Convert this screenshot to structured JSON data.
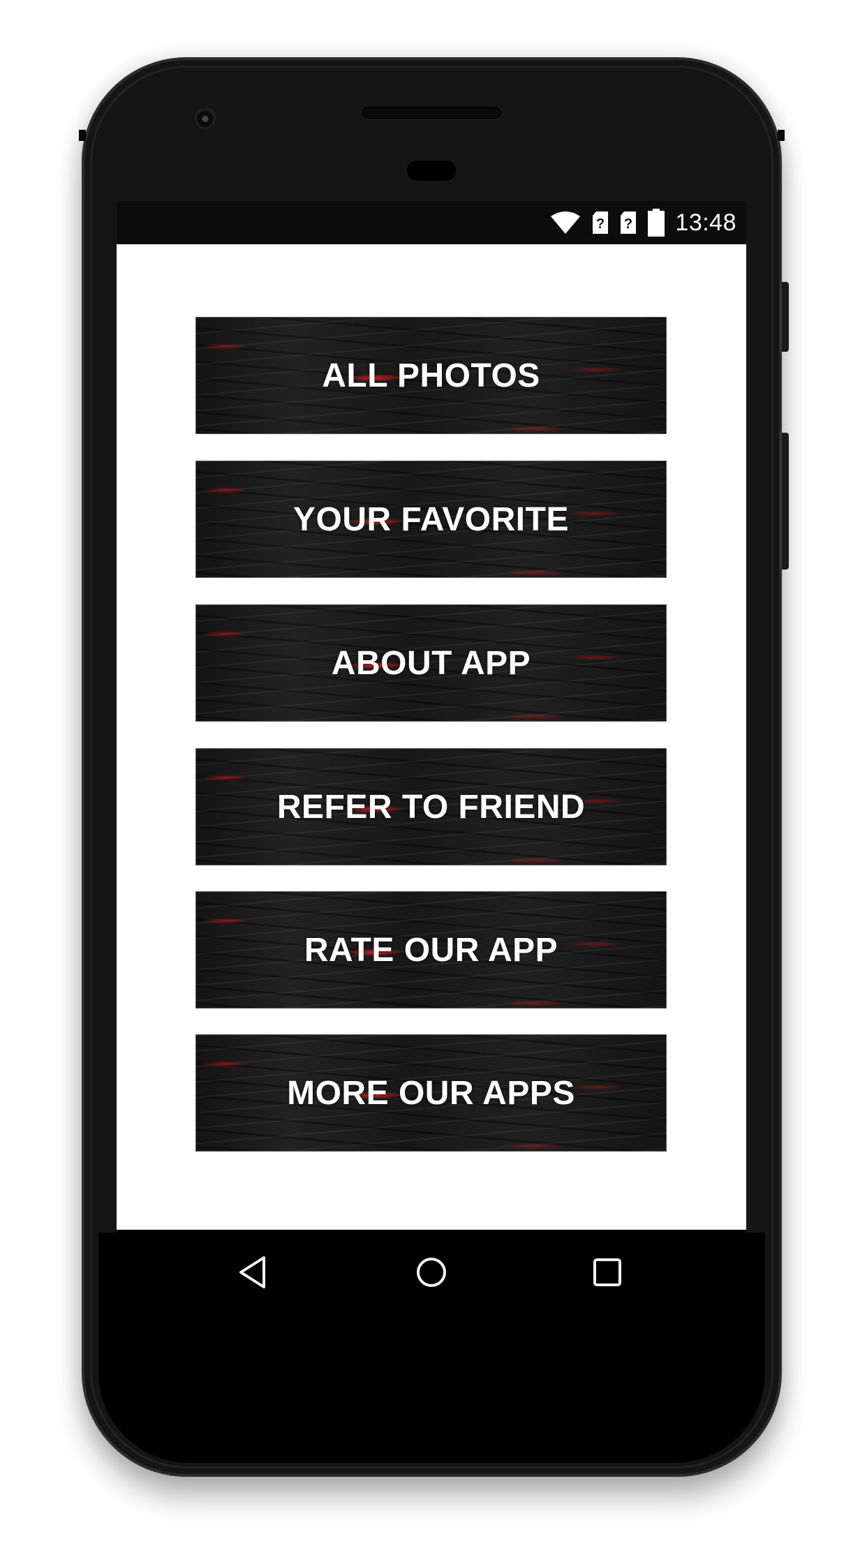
{
  "status_bar": {
    "time": "13:48",
    "icons": [
      "wifi-icon",
      "sim-unknown-icon",
      "sim-unknown-icon",
      "battery-full-icon"
    ]
  },
  "menu": {
    "items": [
      {
        "label": "ALL PHOTOS"
      },
      {
        "label": "YOUR FAVORITE"
      },
      {
        "label": "ABOUT APP"
      },
      {
        "label": "REFER TO FRIEND"
      },
      {
        "label": "RATE OUR APP"
      },
      {
        "label": "MORE OUR APPS"
      }
    ]
  },
  "navigation": {
    "buttons": [
      "back",
      "home",
      "recents"
    ]
  },
  "colors": {
    "button_bg": "#1a1a1a",
    "button_accent": "#e01010",
    "button_text": "#ffffff",
    "screen_bg": "#ffffff",
    "status_bar_bg": "#0d0d0d",
    "nav_bar_bg": "#000000"
  }
}
